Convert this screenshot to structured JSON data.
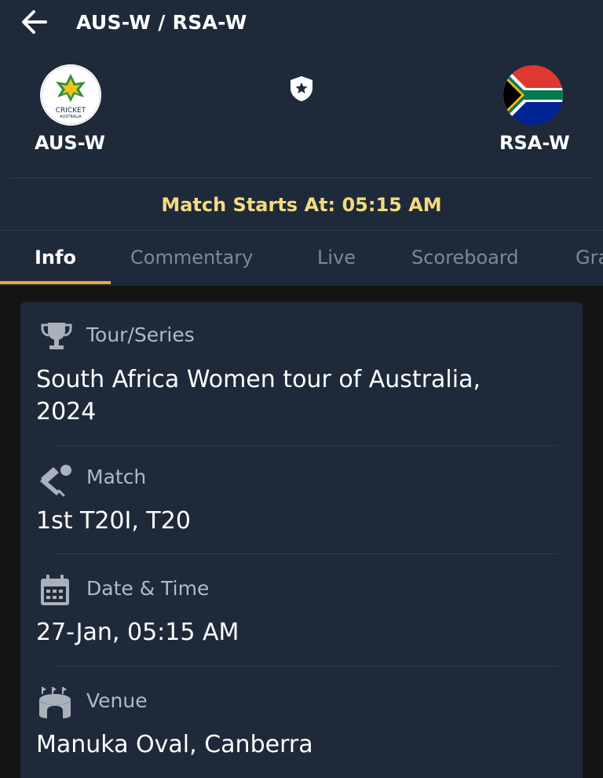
{
  "header": {
    "title": "AUS-W / RSA-W",
    "team_left": {
      "name": "AUS-W",
      "logo_text_1": "CRICKET",
      "logo_text_2": "AUSTRALIA"
    },
    "team_right": {
      "name": "RSA-W"
    },
    "match_starts": "Match Starts At: 05:15 AM"
  },
  "tabs": [
    {
      "label": "Info",
      "active": true
    },
    {
      "label": "Commentary"
    },
    {
      "label": "Live"
    },
    {
      "label": "Scoreboard"
    },
    {
      "label": "Graph"
    }
  ],
  "info": {
    "series": {
      "label": "Tour/Series",
      "value_line1": "South Africa Women tour of Australia,",
      "value_line2": "2024",
      "icon": "trophy-icon"
    },
    "match": {
      "label": "Match",
      "value": "1st T20I, T20",
      "icon": "cricket-bat-ball-icon"
    },
    "datetime": {
      "label": "Date & Time",
      "value": "27-Jan, 05:15 AM",
      "icon": "calendar-icon"
    },
    "venue": {
      "label": "Venue",
      "value": "Manuka Oval, Canberra",
      "icon": "stadium-icon"
    }
  },
  "colors": {
    "background": "#141414",
    "panel": "#1e2a3a",
    "accent": "#f0a04b",
    "match_start": "#f4db7d",
    "muted_text": "#7f8895"
  }
}
